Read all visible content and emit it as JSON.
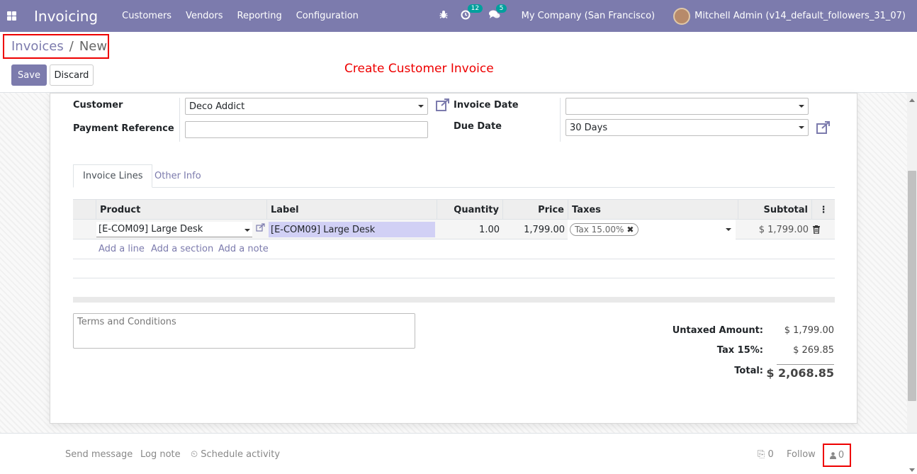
{
  "navbar": {
    "app_title": "Invoicing",
    "menu": [
      "Customers",
      "Vendors",
      "Reporting",
      "Configuration"
    ],
    "activity_count": "12",
    "message_count": "5",
    "company": "My Company (San Francisco)",
    "user": "Mitchell Admin (v14_default_followers_31_07)"
  },
  "control": {
    "breadcrumb_parent": "Invoices",
    "breadcrumb_separator": "/",
    "breadcrumb_current": "New",
    "save_label": "Save",
    "discard_label": "Discard",
    "annotation": "Create Customer Invoice"
  },
  "form": {
    "customer_label": "Customer",
    "customer_value": "Deco Addict",
    "payment_ref_label": "Payment Reference",
    "payment_ref_value": "",
    "invoice_date_label": "Invoice Date",
    "invoice_date_value": "",
    "due_date_label": "Due Date",
    "due_date_value": "30 Days"
  },
  "tabs": [
    "Invoice Lines",
    "Other Info"
  ],
  "table": {
    "headers": {
      "product": "Product",
      "label": "Label",
      "quantity": "Quantity",
      "price": "Price",
      "taxes": "Taxes",
      "subtotal": "Subtotal"
    },
    "row": {
      "product": "[E-COM09] Large Desk",
      "label": "[E-COM09] Large Desk",
      "quantity": "1.00",
      "price": "1,799.00",
      "tax_tag": "Tax 15.00%",
      "subtotal": "$ 1,799.00"
    },
    "add_line": "Add a line",
    "add_section": "Add a section",
    "add_note": "Add a note"
  },
  "terms_placeholder": "Terms and Conditions",
  "totals": {
    "untaxed_label": "Untaxed Amount:",
    "untaxed_value": "$ 1,799.00",
    "tax_label": "Tax 15%:",
    "tax_value": "$ 269.85",
    "total_label": "Total:",
    "total_value": "$ 2,068.85"
  },
  "chatter": {
    "send_message": "Send message",
    "log_note": "Log note",
    "schedule_activity": "Schedule activity",
    "attachments": "0",
    "follow": "Follow",
    "followers": "0"
  },
  "colors": {
    "brand": "#7c7bad",
    "annotation": "#ee0000",
    "label_highlight": "#d1d0f5"
  }
}
